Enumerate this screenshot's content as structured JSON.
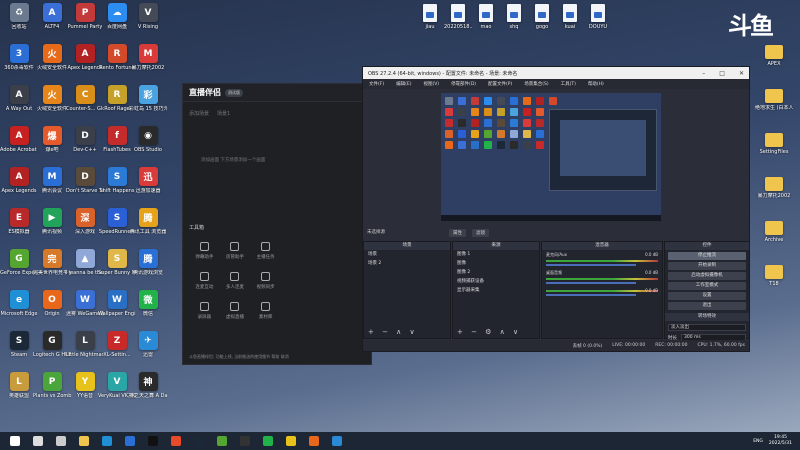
{
  "desktop_left": [
    {
      "label": "回收站",
      "icon": "recycle-bin-icon",
      "color": "#6b7a8f",
      "glyph": "♻"
    },
    {
      "label": "ALTF4",
      "icon": "altf4-icon",
      "color": "#3a6fd8",
      "glyph": "A"
    },
    {
      "label": "Pummel Party",
      "icon": "pummel-party-icon",
      "color": "#c33a3a",
      "glyph": "P"
    },
    {
      "label": "百度网盘",
      "icon": "baidu-netdisk-icon",
      "color": "#2d8cf0",
      "glyph": "☁"
    },
    {
      "label": "V Rising",
      "icon": "v-rising-icon",
      "color": "#444b57",
      "glyph": "V"
    },
    {
      "label": "360杀毒软件",
      "icon": "antivirus-360-icon",
      "color": "#2b6fd6",
      "glyph": "3"
    },
    {
      "label": "火绒安全软件",
      "icon": "huorong-icon",
      "color": "#e66a1a",
      "glyph": "火"
    },
    {
      "label": "Apex Legends",
      "icon": "apex-icon",
      "color": "#b22222",
      "glyph": "A"
    },
    {
      "label": "Rento Fortune",
      "icon": "rento-icon",
      "color": "#d24a2a",
      "glyph": "R"
    },
    {
      "label": "暴力摩托2002",
      "icon": "moto-game-icon",
      "color": "#d93a3a",
      "glyph": "M"
    },
    {
      "label": "A Way Out",
      "icon": "a-way-out-icon",
      "color": "#3a3f49",
      "glyph": "A"
    },
    {
      "label": "火绒安全软件",
      "icon": "huorong-shield-icon",
      "color": "#e6861a",
      "glyph": "火"
    },
    {
      "label": "Counter-S... Global Off...",
      "icon": "csgo-icon",
      "color": "#d98e1a",
      "glyph": "C"
    },
    {
      "label": "Roof Rage",
      "icon": "roof-rage-icon",
      "color": "#c6a12a",
      "glyph": "R"
    },
    {
      "label": "彩虹岛 15 技巧元",
      "icon": "game-tool-icon",
      "color": "#4aa3e0",
      "glyph": "彩"
    },
    {
      "label": "Adobe Acrobat 7.0",
      "icon": "acrobat-icon",
      "color": "#c72020",
      "glyph": "A"
    },
    {
      "label": "爆e吧",
      "icon": "baoe-icon",
      "color": "#e45a2a",
      "glyph": "爆"
    },
    {
      "label": "Dev-C++",
      "icon": "dev-cpp-icon",
      "color": "#3a3f49",
      "glyph": "D"
    },
    {
      "label": "FlashTubes",
      "icon": "flash-icon",
      "color": "#c42c2c",
      "glyph": "f"
    },
    {
      "label": "OBS Studio",
      "icon": "obs-icon",
      "color": "#2a2a2a",
      "glyph": "◉"
    },
    {
      "label": "Apex Legends",
      "icon": "apex-icon-2",
      "color": "#b22222",
      "glyph": "A"
    },
    {
      "label": "腾讯会议",
      "icon": "tencent-meeting-icon",
      "color": "#2b6fd6",
      "glyph": "M"
    },
    {
      "label": "Don't Starve Together",
      "icon": "dont-starve-icon",
      "color": "#5a4a3a",
      "glyph": "D"
    },
    {
      "label": "Shift Happens",
      "icon": "shift-happens-icon",
      "color": "#2a7ad6",
      "glyph": "S"
    },
    {
      "label": "迅游加速器",
      "icon": "booster-icon",
      "color": "#d93a3a",
      "glyph": "迅"
    },
    {
      "label": "ES模拟器",
      "icon": "emulator-icon",
      "color": "#b82a2a",
      "glyph": "E"
    },
    {
      "label": "腾讯视频",
      "icon": "tencent-video-icon",
      "color": "#22a35a",
      "glyph": "▶"
    },
    {
      "label": "深入游戏",
      "icon": "game-depth-icon",
      "color": "#d9622a",
      "glyph": "深"
    },
    {
      "label": "SpeedRunners",
      "icon": "speedrunners-icon",
      "color": "#2a5fd6",
      "glyph": "S"
    },
    {
      "label": "腾讯工具 浏览器",
      "icon": "browser-tool-icon",
      "color": "#e6a21a",
      "glyph": "腾"
    },
    {
      "label": "GeForce Experience",
      "icon": "geforce-icon",
      "color": "#55a630",
      "glyph": "G"
    },
    {
      "label": "完美世界电竞平台",
      "icon": "perfect-world-icon",
      "color": "#d6792a",
      "glyph": "完"
    },
    {
      "label": "I wanna be the Creator",
      "icon": "iwanna-icon",
      "color": "#8fa8d8",
      "glyph": "▲"
    },
    {
      "label": "Super Bunny Man",
      "icon": "super-bunny-icon",
      "color": "#e0b84a",
      "glyph": "S"
    },
    {
      "label": "腾讯游戏浏览",
      "icon": "tencent-game-icon",
      "color": "#2a6fd6",
      "glyph": "腾"
    },
    {
      "label": "Microsoft Edge",
      "icon": "edge-icon",
      "color": "#1f8fd6",
      "glyph": "e"
    },
    {
      "label": "Origin",
      "icon": "origin-icon",
      "color": "#e8671a",
      "glyph": "O"
    },
    {
      "label": "迷雾 WeGame版",
      "icon": "wegame-icon",
      "color": "#3a6fd6",
      "glyph": "W"
    },
    {
      "label": "Wallpaper Engine",
      "icon": "wallpaper-engine-icon",
      "color": "#2a6fc6",
      "glyph": "W"
    },
    {
      "label": "微信",
      "icon": "wechat-icon",
      "color": "#22b24a",
      "glyph": "微"
    },
    {
      "label": "Steam",
      "icon": "steam-icon",
      "color": "#1b2838",
      "glyph": "S"
    },
    {
      "label": "Logitech G HUB",
      "icon": "logitech-icon",
      "color": "#2a2a2a",
      "glyph": "G"
    },
    {
      "label": "Little Nightmares",
      "icon": "little-nightmares-icon",
      "color": "#3a3f49",
      "glyph": "L"
    },
    {
      "label": "XL-Settin...",
      "icon": "xl-settings-icon",
      "color": "#c82a2a",
      "glyph": "Z"
    },
    {
      "label": "迅雷",
      "icon": "thunder-icon",
      "color": "#2a8ad6",
      "glyph": "✈"
    },
    {
      "label": "英雄联盟",
      "icon": "lol-icon",
      "color": "#c89b3c",
      "glyph": "L"
    },
    {
      "label": "Plants vs Zombies G...",
      "icon": "pvz-icon",
      "color": "#4aa63a",
      "glyph": "P"
    },
    {
      "label": "YY语音",
      "icon": "yy-icon",
      "color": "#e6c21a",
      "glyph": "Y"
    },
    {
      "label": "VeryKuai VK加速器",
      "icon": "verykuai-icon",
      "color": "#2aa6a6",
      "glyph": "V"
    },
    {
      "label": "神之天之舞 A Dance of F...",
      "icon": "dance-game-icon",
      "color": "#2a2a2a",
      "glyph": "神"
    }
  ],
  "desktop_top_files": [
    "jiau",
    "20220518...",
    "mao",
    "shq",
    "gogo",
    "kuai",
    "DOUYU"
  ],
  "desktop_right": [
    {
      "label": "APEX",
      "type": "folder"
    },
    {
      "label": "绝地求生 (白本人)游戏",
      "type": "folder"
    },
    {
      "label": "SettingFiles",
      "type": "folder"
    },
    {
      "label": "暴力摩托2002",
      "type": "folder"
    },
    {
      "label": "Archive",
      "type": "folder"
    },
    {
      "label": "T18",
      "type": "folder"
    }
  ],
  "watermark": "斗鱼",
  "stream_app": {
    "logo": "直播伴侣",
    "badge": "测试版",
    "tabs": [
      "添加场景",
      "场景1",
      "直播设置"
    ],
    "hint": "添加画面 下方场景添加一个画面",
    "room_note": "房间须知: 开播前请先设置好开播信息",
    "category": "APEX - 射击上手",
    "room_tag": "Vwxo",
    "toolbox_label": "工具箱",
    "tools": [
      "弹幕助手",
      "房管助手",
      "主播任务",
      "连麦互动",
      "多人连麦",
      "视频同步",
      "录屏器",
      "虚拟直播",
      "素材库"
    ],
    "footer": "斗鱼直播伴侣: 功能上线, 当前推送的使用细节 帮助 取消"
  },
  "obs": {
    "title": "OBS 27.2.4 (64-bit, windows) - 配置文件: 未命名 - 场景: 未命名",
    "menu": [
      "文件(F)",
      "编辑(E)",
      "视图(V)",
      "停靠部件(D)",
      "配置文件(P)",
      "场景集合(S)",
      "工具(T)",
      "帮助(H)"
    ],
    "no_source": "未选择源",
    "preview_controls": [
      "属性",
      "滤镜"
    ],
    "docks": {
      "scenes": {
        "title": "场景",
        "items": [
          "场景",
          "场景 2"
        ]
      },
      "sources": {
        "title": "来源",
        "items": [
          "图像 1",
          "图像",
          "图像 2",
          "视频捕获设备",
          "显示器采集"
        ]
      },
      "mixer": {
        "title": "混音器",
        "tracks": [
          {
            "name": "麦克风/Aux",
            "db": "0.0 dB"
          },
          {
            "name": "桌面音频",
            "db": "0.0 dB"
          },
          {
            "name": "",
            "db": "0.0 dB"
          }
        ]
      },
      "controls": {
        "title": "控件",
        "buttons": [
          "停止推流",
          "开始录制",
          "启动虚拟摄像机",
          "工作室模式",
          "设置",
          "退出"
        ],
        "transition_title": "转场特效",
        "transition_value": "淡入淡出",
        "duration_label": "时长",
        "duration_value": "300 ms"
      }
    },
    "status": {
      "frames": "丢帧 0 (0.0%)",
      "live": "LIVE: 00:00:00",
      "rec": "REC: 00:00:00",
      "cpu": "CPU: 1.7%, 60.00 fps"
    }
  },
  "taskbar": {
    "items": [
      "start",
      "search",
      "task-view",
      "file-explorer",
      "edge",
      "store",
      "tiktok",
      "douyu",
      "steam",
      "xbox",
      "obs",
      "wechat",
      "game",
      "origin",
      "thunder"
    ],
    "lang": "ENG",
    "time": "19:45",
    "date": "2022/5/31"
  }
}
